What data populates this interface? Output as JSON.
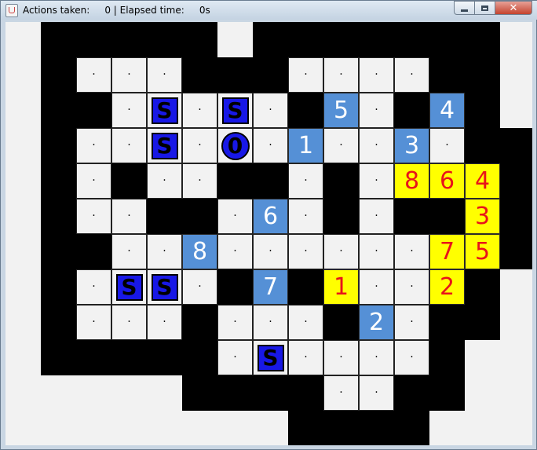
{
  "window": {
    "title": "Actions taken:     0 | Elapsed time:     0s",
    "minimize_label": "minimize",
    "maximize_label": "maximize",
    "close_label": "close"
  },
  "colors": {
    "wall": "#000000",
    "floor": "#f2f2f2",
    "blue_tile": "#5590d6",
    "yellow_tile": "#ffff00",
    "yellow_text": "#e8131a",
    "piece": "#1818e6"
  },
  "legend": {
    "W": "wall",
    "E": "empty outside area",
    ".": "floor",
    "S": "S piece",
    "0": "0 piece (circle)",
    "b1-b8": "blue numbered tile",
    "y1-y8": "yellow numbered tile (red text)"
  },
  "grid": [
    [
      "E",
      "W",
      "W",
      "W",
      "W",
      "W",
      "E",
      "W",
      "W",
      "W",
      "W",
      "W",
      "W",
      "W",
      "E"
    ],
    [
      "E",
      "W",
      ".",
      ".",
      ".",
      "W",
      "W",
      "W",
      ".",
      ".",
      ".",
      ".",
      "W",
      "W",
      "E"
    ],
    [
      "E",
      "W",
      "W",
      ".",
      "S",
      ".",
      "S",
      ".",
      "W",
      "b5",
      ".",
      "W",
      "b4",
      "W",
      "E"
    ],
    [
      "E",
      "W",
      ".",
      ".",
      "S",
      ".",
      "0",
      ".",
      "b1",
      ".",
      ".",
      "b3",
      ".",
      "W",
      "W"
    ],
    [
      "E",
      "W",
      ".",
      "W",
      ".",
      ".",
      "W",
      "W",
      ".",
      "W",
      ".",
      "y8",
      "y6",
      "y4",
      "W"
    ],
    [
      "E",
      "W",
      ".",
      ".",
      "W",
      "W",
      ".",
      "b6",
      ".",
      "W",
      ".",
      "W",
      "W",
      "y3",
      "W"
    ],
    [
      "E",
      "W",
      "W",
      ".",
      ".",
      "b8",
      ".",
      ".",
      ".",
      ".",
      ".",
      ".",
      "y7",
      "y5",
      "W"
    ],
    [
      "E",
      "W",
      ".",
      "S",
      "S",
      ".",
      "W",
      "b7",
      "W",
      "y1",
      ".",
      ".",
      "y2",
      "W",
      "E"
    ],
    [
      "E",
      "W",
      ".",
      ".",
      ".",
      "W",
      ".",
      ".",
      ".",
      "W",
      "b2",
      ".",
      "W",
      "W",
      "E"
    ],
    [
      "E",
      "W",
      "W",
      "W",
      "W",
      "W",
      ".",
      "S",
      ".",
      ".",
      ".",
      ".",
      "W",
      "E",
      "E"
    ],
    [
      "E",
      "E",
      "E",
      "E",
      "E",
      "W",
      "W",
      "W",
      "W",
      ".",
      ".",
      "W",
      "W",
      "E",
      "E"
    ],
    [
      "E",
      "E",
      "E",
      "E",
      "E",
      "E",
      "E",
      "E",
      "W",
      "W",
      "W",
      "W",
      "E",
      "E",
      "E"
    ]
  ]
}
